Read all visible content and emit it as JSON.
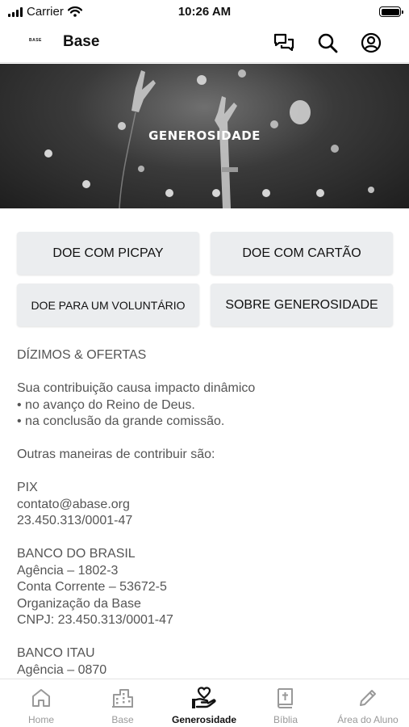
{
  "status_bar": {
    "carrier": "Carrier",
    "time": "10:26 AM"
  },
  "header": {
    "logo_text": "BASE",
    "title": "Base",
    "icons": [
      "chat-icon",
      "search-icon",
      "profile-icon"
    ]
  },
  "hero": {
    "title": "GENEROSIDADE"
  },
  "buttons": {
    "picpay": "DOE COM PICPAY",
    "cartao": "DOE COM CARTÃO",
    "voluntario": "DOE PARA UM VOLUNTÁRIO",
    "sobre": "SOBRE GENEROSIDADE"
  },
  "content": {
    "heading": "DÍZIMOS & OFERTAS",
    "intro": "Sua contribuição causa impacto dinâmico\n• no avanço do Reino de Deus.\n• na conclusão da grande comissão.",
    "outras": "Outras maneiras de contribuir são:",
    "pix": "PIX\ncontato@abase.org\n23.450.313/0001-47",
    "bb": "BANCO DO BRASIL\nAgência – 1802-3\nConta Corrente – 53672-5\nOrganização da Base\nCNPJ: 23.450.313/0001-47",
    "itau": "BANCO ITAU\nAgência – 0870"
  },
  "tabs": [
    {
      "label": "Home",
      "icon": "home-icon"
    },
    {
      "label": "Base",
      "icon": "buildings-icon"
    },
    {
      "label": "Generosidade",
      "icon": "giving-hand-icon",
      "active": true
    },
    {
      "label": "Bíblia",
      "icon": "bible-icon"
    },
    {
      "label": "Área do Aluno",
      "icon": "pencil-icon"
    }
  ],
  "colors": {
    "button_bg": "#ebedef",
    "text_muted": "#555555",
    "tab_inactive": "#999999"
  }
}
